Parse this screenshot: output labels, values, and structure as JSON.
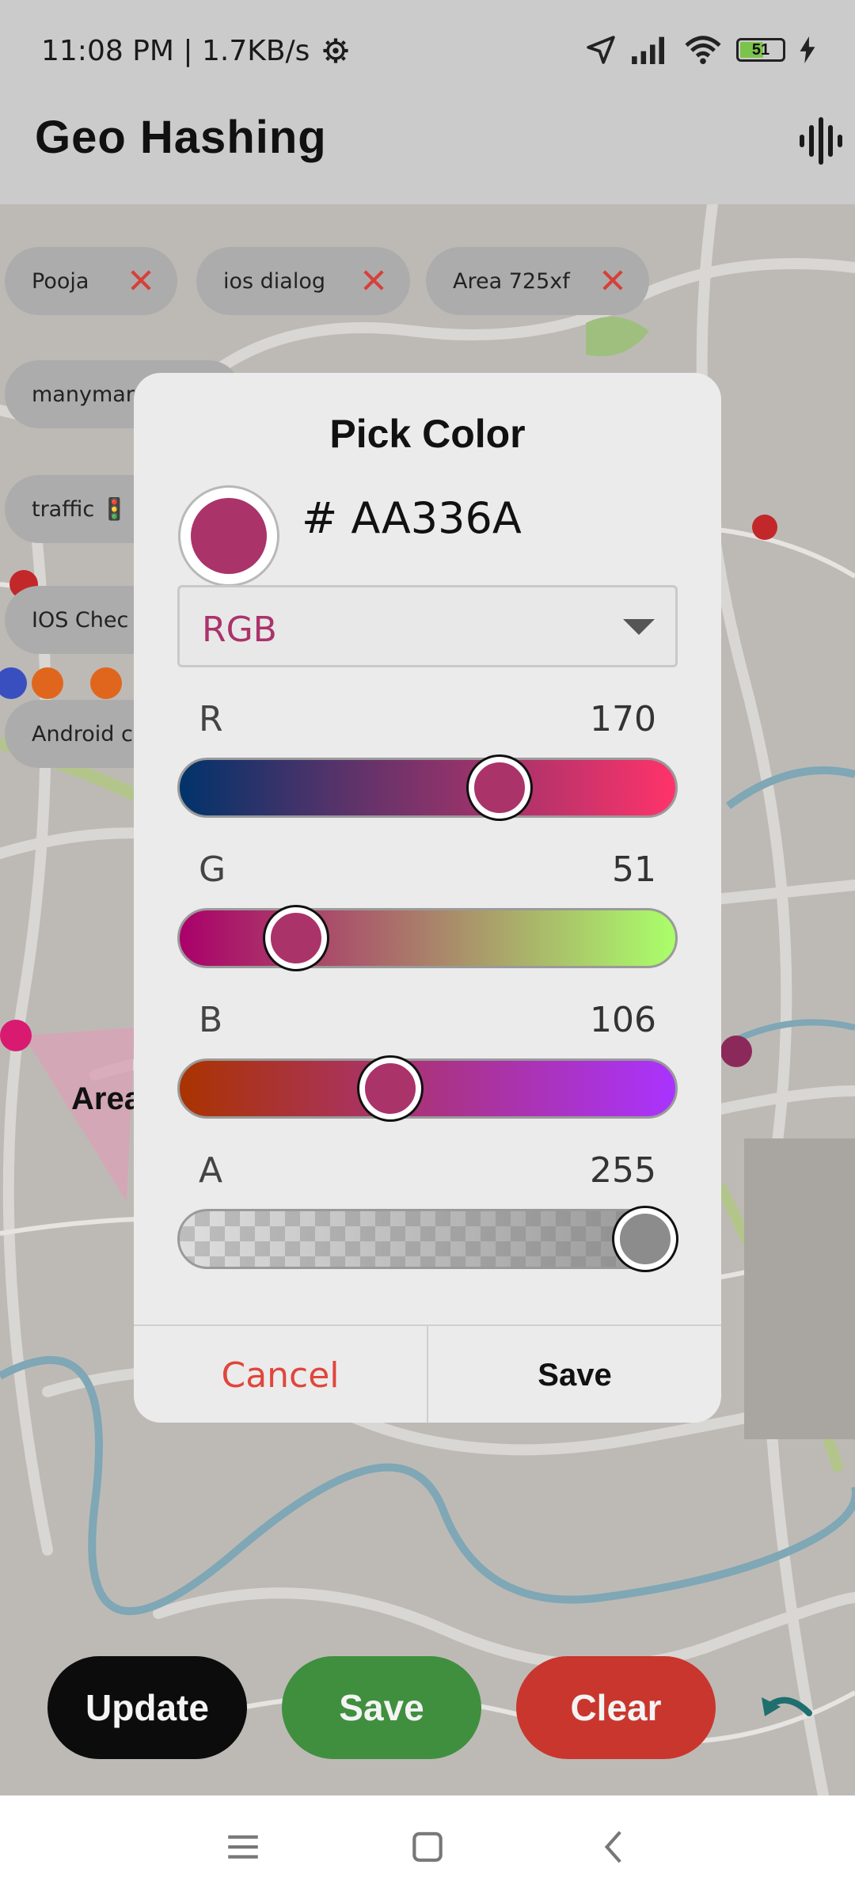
{
  "status_bar": {
    "time_speed": "11:08 PM | 1.7KB/s",
    "battery": "51"
  },
  "app_bar": {
    "title": "Geo Hashing"
  },
  "chips": [
    {
      "label": "Pooja"
    },
    {
      "label": "ios dialog"
    },
    {
      "label": "Area 725xf"
    },
    {
      "label": "manymar"
    },
    {
      "label": "traffic 🚦"
    },
    {
      "label": "IOS Chec"
    },
    {
      "label": "Android c"
    }
  ],
  "map": {
    "area_label": "Area"
  },
  "dialog": {
    "title": "Pick Color",
    "hex_value": "# AA336A",
    "color_mode": "RGB",
    "channels": [
      {
        "label": "R",
        "value": "170"
      },
      {
        "label": "G",
        "value": "51"
      },
      {
        "label": "B",
        "value": "106"
      },
      {
        "label": "A",
        "value": "255"
      }
    ],
    "cancel_label": "Cancel",
    "save_label": "Save"
  },
  "bottom_actions": {
    "update_label": "Update",
    "save_label": "Save",
    "clear_label": "Clear"
  },
  "colors": {
    "selected_color": "#AA336A",
    "update_button": "#0c0c0c",
    "save_button": "#3f8f3f",
    "clear_button": "#c9362e",
    "cancel_text": "#e0463b",
    "undo_icon": "#1f6f6f"
  },
  "icons": {
    "status": [
      "settings-gear-icon",
      "location-arrow-icon",
      "signal-icon",
      "wifi-icon",
      "battery-icon",
      "charging-icon"
    ],
    "app_bar": "voice-waveform-icon",
    "chip_close": "close-icon",
    "undo": "undo-icon",
    "nav": [
      "menu-icon",
      "home-icon",
      "back-icon"
    ]
  }
}
